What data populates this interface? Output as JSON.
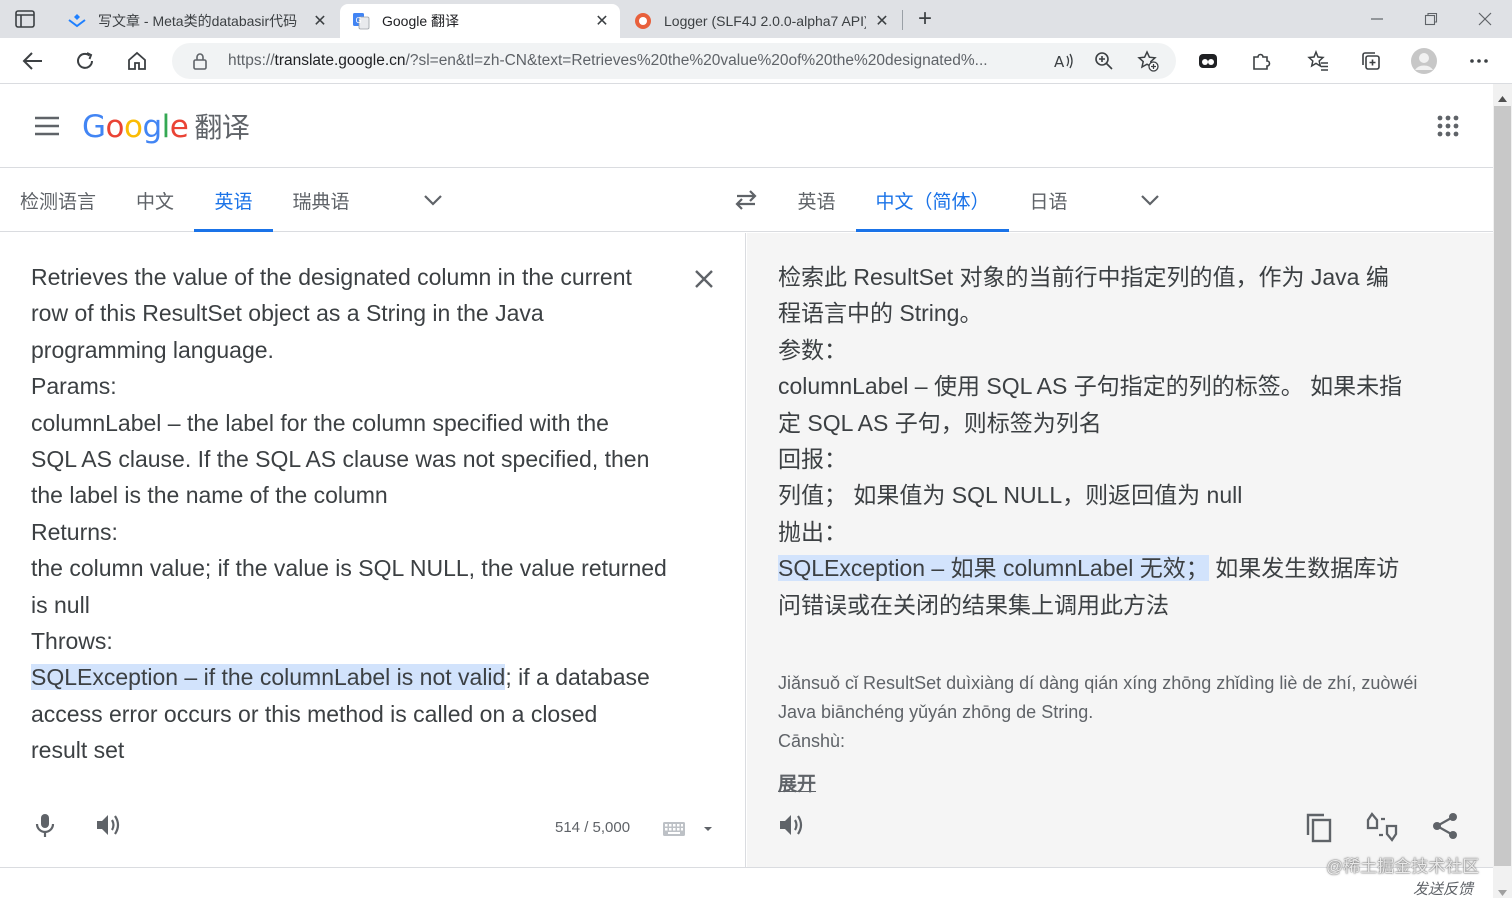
{
  "browser": {
    "tabs": [
      {
        "title": "写文章 - Meta类的databasir代码",
        "state": "inactive"
      },
      {
        "title": "Google 翻译",
        "state": "active"
      },
      {
        "title": "Logger (SLF4J 2.0.0-alpha7 API)",
        "state": "inactive"
      }
    ],
    "url_prefix": "https://",
    "url_host": "translate.google.cn",
    "url_rest": "/?sl=en&tl=zh-CN&text=Retrieves%20the%20value%20of%20the%20designated%...",
    "icons": [
      "back-icon",
      "reload-icon",
      "home-icon",
      "lock-icon",
      "read-aloud-icon",
      "zoom-icon",
      "add-favorite-icon",
      "extension-icon",
      "puzzle-icon",
      "favorites-icon",
      "collections-icon",
      "profile-icon",
      "more-icon"
    ]
  },
  "header": {
    "logo_letters": [
      "G",
      "o",
      "o",
      "g",
      "l",
      "e"
    ],
    "product": "翻译"
  },
  "source_langs": {
    "items": [
      "检测语言",
      "中文",
      "英语",
      "瑞典语"
    ],
    "active_index": 2
  },
  "target_langs": {
    "items": [
      "英语",
      "中文（简体）",
      "日语"
    ],
    "active_index": 1
  },
  "source": {
    "lines": [
      "Retrieves the value of the designated column in the current",
      "row of this ResultSet object as a String in the Java",
      "programming language.",
      "Params:",
      "columnLabel – the label for the column specified with the",
      "SQL AS clause. If the SQL AS clause was not specified, then",
      "the label is the name of the column",
      "Returns:",
      "the column value; if the value is SQL NULL, the value returned",
      "is null",
      "Throws:"
    ],
    "highlight_line": {
      "highlighted": "SQLException – if the columnLabel is not valid",
      "rest": "; if a database"
    },
    "tail_lines": [
      "access error occurs or this method is called on a closed",
      "result set"
    ],
    "char_count": "514 / 5,000"
  },
  "target": {
    "lines": [
      "检索此 ResultSet 对象的当前行中指定列的值，作为 Java 编",
      "程语言中的 String。",
      "参数：",
      "columnLabel – 使用 SQL AS 子句指定的列的标签。 如果未指",
      "定 SQL AS 子句，则标签为列名",
      "回报：",
      "列值； 如果值为 SQL NULL，则返回值为 null",
      "抛出："
    ],
    "highlight_line": {
      "highlighted": "SQLException – 如果 columnLabel 无效；",
      "rest": " 如果发生数据库访"
    },
    "tail_lines": [
      "问错误或在关闭的结果集上调用此方法"
    ],
    "romanization": [
      "Jiǎnsuǒ cǐ ResultSet duìxiàng dí dàng qián xíng zhōng zhǐdìng liè de zhí, zuòwéi",
      "Java biānchéng yǔyán zhōng de String.",
      "Cānshù:"
    ],
    "expand": "展开"
  },
  "footer": {
    "feedback": "发送反馈",
    "watermark": "@稀土掘金技术社区"
  },
  "colors": {
    "accent": "#1a73e8",
    "highlight": "#d2e3fc",
    "target_bg": "#f5f5f5"
  }
}
